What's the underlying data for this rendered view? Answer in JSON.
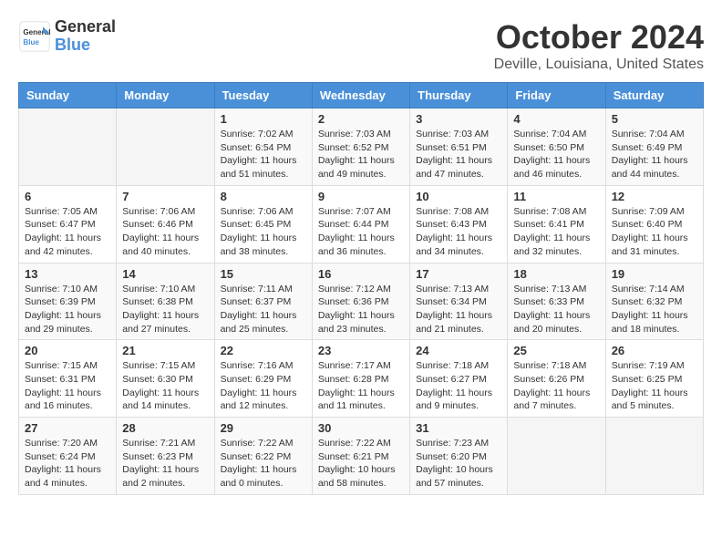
{
  "header": {
    "logo_general": "General",
    "logo_blue": "Blue",
    "month_year": "October 2024",
    "location": "Deville, Louisiana, United States"
  },
  "days_of_week": [
    "Sunday",
    "Monday",
    "Tuesday",
    "Wednesday",
    "Thursday",
    "Friday",
    "Saturday"
  ],
  "weeks": [
    [
      {
        "day": "",
        "info": ""
      },
      {
        "day": "",
        "info": ""
      },
      {
        "day": "1",
        "info": "Sunrise: 7:02 AM\nSunset: 6:54 PM\nDaylight: 11 hours and 51 minutes."
      },
      {
        "day": "2",
        "info": "Sunrise: 7:03 AM\nSunset: 6:52 PM\nDaylight: 11 hours and 49 minutes."
      },
      {
        "day": "3",
        "info": "Sunrise: 7:03 AM\nSunset: 6:51 PM\nDaylight: 11 hours and 47 minutes."
      },
      {
        "day": "4",
        "info": "Sunrise: 7:04 AM\nSunset: 6:50 PM\nDaylight: 11 hours and 46 minutes."
      },
      {
        "day": "5",
        "info": "Sunrise: 7:04 AM\nSunset: 6:49 PM\nDaylight: 11 hours and 44 minutes."
      }
    ],
    [
      {
        "day": "6",
        "info": "Sunrise: 7:05 AM\nSunset: 6:47 PM\nDaylight: 11 hours and 42 minutes."
      },
      {
        "day": "7",
        "info": "Sunrise: 7:06 AM\nSunset: 6:46 PM\nDaylight: 11 hours and 40 minutes."
      },
      {
        "day": "8",
        "info": "Sunrise: 7:06 AM\nSunset: 6:45 PM\nDaylight: 11 hours and 38 minutes."
      },
      {
        "day": "9",
        "info": "Sunrise: 7:07 AM\nSunset: 6:44 PM\nDaylight: 11 hours and 36 minutes."
      },
      {
        "day": "10",
        "info": "Sunrise: 7:08 AM\nSunset: 6:43 PM\nDaylight: 11 hours and 34 minutes."
      },
      {
        "day": "11",
        "info": "Sunrise: 7:08 AM\nSunset: 6:41 PM\nDaylight: 11 hours and 32 minutes."
      },
      {
        "day": "12",
        "info": "Sunrise: 7:09 AM\nSunset: 6:40 PM\nDaylight: 11 hours and 31 minutes."
      }
    ],
    [
      {
        "day": "13",
        "info": "Sunrise: 7:10 AM\nSunset: 6:39 PM\nDaylight: 11 hours and 29 minutes."
      },
      {
        "day": "14",
        "info": "Sunrise: 7:10 AM\nSunset: 6:38 PM\nDaylight: 11 hours and 27 minutes."
      },
      {
        "day": "15",
        "info": "Sunrise: 7:11 AM\nSunset: 6:37 PM\nDaylight: 11 hours and 25 minutes."
      },
      {
        "day": "16",
        "info": "Sunrise: 7:12 AM\nSunset: 6:36 PM\nDaylight: 11 hours and 23 minutes."
      },
      {
        "day": "17",
        "info": "Sunrise: 7:13 AM\nSunset: 6:34 PM\nDaylight: 11 hours and 21 minutes."
      },
      {
        "day": "18",
        "info": "Sunrise: 7:13 AM\nSunset: 6:33 PM\nDaylight: 11 hours and 20 minutes."
      },
      {
        "day": "19",
        "info": "Sunrise: 7:14 AM\nSunset: 6:32 PM\nDaylight: 11 hours and 18 minutes."
      }
    ],
    [
      {
        "day": "20",
        "info": "Sunrise: 7:15 AM\nSunset: 6:31 PM\nDaylight: 11 hours and 16 minutes."
      },
      {
        "day": "21",
        "info": "Sunrise: 7:15 AM\nSunset: 6:30 PM\nDaylight: 11 hours and 14 minutes."
      },
      {
        "day": "22",
        "info": "Sunrise: 7:16 AM\nSunset: 6:29 PM\nDaylight: 11 hours and 12 minutes."
      },
      {
        "day": "23",
        "info": "Sunrise: 7:17 AM\nSunset: 6:28 PM\nDaylight: 11 hours and 11 minutes."
      },
      {
        "day": "24",
        "info": "Sunrise: 7:18 AM\nSunset: 6:27 PM\nDaylight: 11 hours and 9 minutes."
      },
      {
        "day": "25",
        "info": "Sunrise: 7:18 AM\nSunset: 6:26 PM\nDaylight: 11 hours and 7 minutes."
      },
      {
        "day": "26",
        "info": "Sunrise: 7:19 AM\nSunset: 6:25 PM\nDaylight: 11 hours and 5 minutes."
      }
    ],
    [
      {
        "day": "27",
        "info": "Sunrise: 7:20 AM\nSunset: 6:24 PM\nDaylight: 11 hours and 4 minutes."
      },
      {
        "day": "28",
        "info": "Sunrise: 7:21 AM\nSunset: 6:23 PM\nDaylight: 11 hours and 2 minutes."
      },
      {
        "day": "29",
        "info": "Sunrise: 7:22 AM\nSunset: 6:22 PM\nDaylight: 11 hours and 0 minutes."
      },
      {
        "day": "30",
        "info": "Sunrise: 7:22 AM\nSunset: 6:21 PM\nDaylight: 10 hours and 58 minutes."
      },
      {
        "day": "31",
        "info": "Sunrise: 7:23 AM\nSunset: 6:20 PM\nDaylight: 10 hours and 57 minutes."
      },
      {
        "day": "",
        "info": ""
      },
      {
        "day": "",
        "info": ""
      }
    ]
  ]
}
